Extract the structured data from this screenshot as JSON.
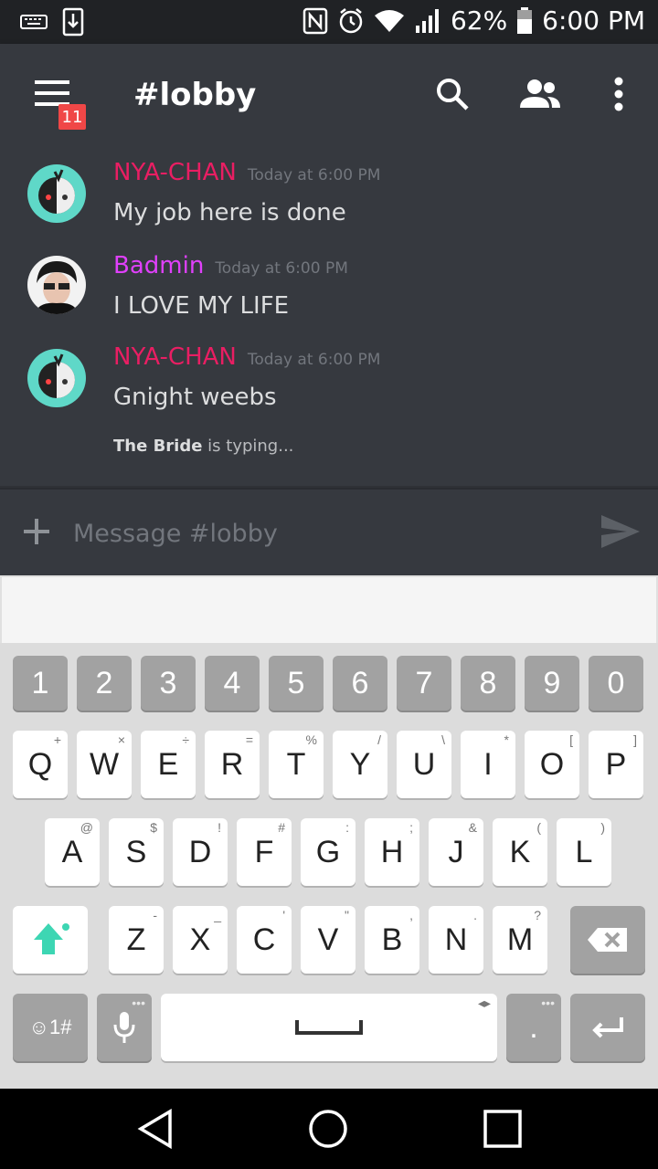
{
  "status_bar": {
    "battery": "62%",
    "time": "6:00 PM",
    "icons": [
      "keyboard-icon",
      "download-icon",
      "nfc-icon",
      "alarm-icon",
      "wifi-icon",
      "signal-icon",
      "battery-icon"
    ]
  },
  "header": {
    "menu_badge": "11",
    "channel": "#lobby",
    "icons": [
      "menu-icon",
      "search-icon",
      "members-icon",
      "more-vert-icon"
    ]
  },
  "messages": [
    {
      "author": "NYA-CHAN",
      "time": "Today at 6:00 PM",
      "text": "My job here is done",
      "color": "#e91e63"
    },
    {
      "author": "Badmin",
      "time": "Today at 6:00 PM",
      "text": "I LOVE MY LIFE",
      "color": "#e040fb"
    },
    {
      "author": "NYA-CHAN",
      "time": "Today at 6:00 PM",
      "text": "Gnight weebs",
      "color": "#e91e63"
    }
  ],
  "typing": {
    "user": "The Bride",
    "suffix": " is typing..."
  },
  "composer": {
    "placeholder": "Message #lobby"
  },
  "keyboard": {
    "numbers": [
      "1",
      "2",
      "3",
      "4",
      "5",
      "6",
      "7",
      "8",
      "9",
      "0"
    ],
    "row1": [
      {
        "k": "Q",
        "s": "+"
      },
      {
        "k": "W",
        "s": "×"
      },
      {
        "k": "E",
        "s": "÷"
      },
      {
        "k": "R",
        "s": "="
      },
      {
        "k": "T",
        "s": "%"
      },
      {
        "k": "Y",
        "s": "/"
      },
      {
        "k": "U",
        "s": "\\"
      },
      {
        "k": "I",
        "s": "*"
      },
      {
        "k": "O",
        "s": "["
      },
      {
        "k": "P",
        "s": "]"
      }
    ],
    "row2": [
      {
        "k": "A",
        "s": "@"
      },
      {
        "k": "S",
        "s": "$"
      },
      {
        "k": "D",
        "s": "!"
      },
      {
        "k": "F",
        "s": "#"
      },
      {
        "k": "G",
        "s": ":"
      },
      {
        "k": "H",
        "s": ";"
      },
      {
        "k": "J",
        "s": "&"
      },
      {
        "k": "K",
        "s": "("
      },
      {
        "k": "L",
        "s": ")"
      }
    ],
    "row3": [
      {
        "k": "Z",
        "s": "-"
      },
      {
        "k": "X",
        "s": "_"
      },
      {
        "k": "C",
        "s": "'"
      },
      {
        "k": "V",
        "s": "\""
      },
      {
        "k": "B",
        "s": ","
      },
      {
        "k": "N",
        "s": "."
      },
      {
        "k": "M",
        "s": "?"
      }
    ],
    "symbols_label": "☺1#",
    "period": ".",
    "period_sub": "•••",
    "mic_sub": "•••",
    "space_sub": "◂▸"
  },
  "colors": {
    "background": "#36393f",
    "status_bar": "#202225",
    "accent_shift": "#3dd6b3",
    "badge": "#f04747"
  }
}
